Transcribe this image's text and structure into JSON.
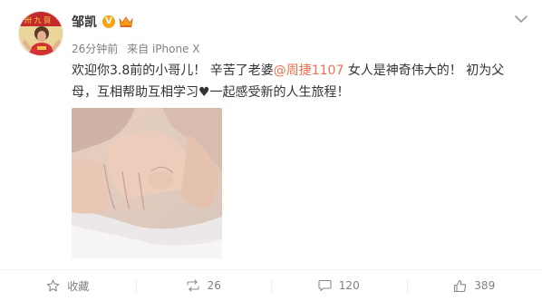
{
  "post": {
    "author": "邹凯",
    "time": "26分钟前",
    "source": "来自 iPhone X",
    "text_before": "欢迎你3.8前的小哥儿！ 辛苦了老婆",
    "mention": "@周捷1107",
    "text_after": " 女人是神奇伟大的！ 初为父母，互相帮助互相学习♥一起感受新的人生旅程！",
    "verified_badge": "V"
  },
  "actions": {
    "favorite_label": "收藏",
    "repost_count": "26",
    "comment_count": "120",
    "like_count": "389"
  },
  "icons": [
    "chevron-down-icon",
    "verified-icon",
    "crown-icon",
    "favorite-icon",
    "repost-icon",
    "comment-icon",
    "like-icon"
  ],
  "colors": {
    "mention": "#eb7350",
    "verified": "#f7a517",
    "meta": "#808080",
    "text": "#333333"
  }
}
